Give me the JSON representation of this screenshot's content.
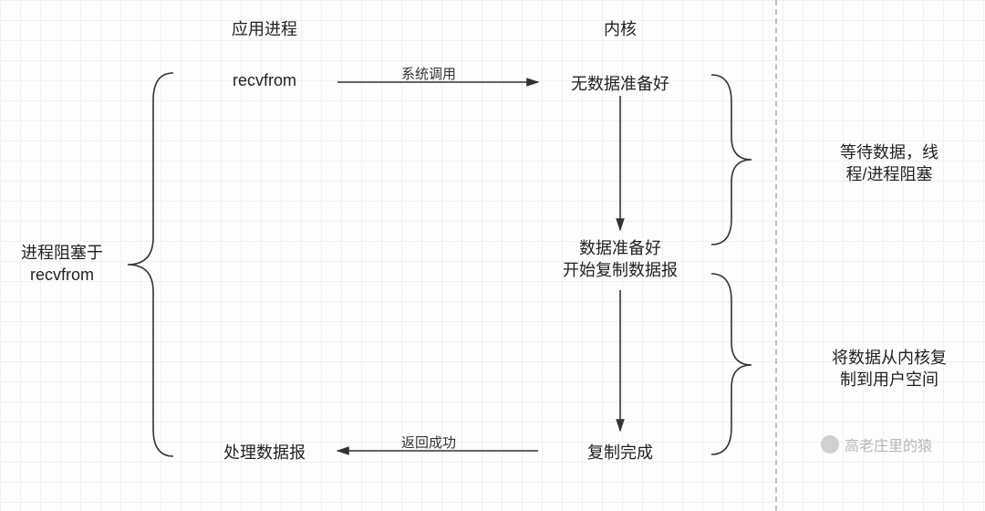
{
  "headers": {
    "app_process": "应用进程",
    "kernel": "内核"
  },
  "left": {
    "blocked_label": "进程阻塞于\nrecvfrom"
  },
  "app_col": {
    "recvfrom": "recvfrom",
    "process_datagram": "处理数据报"
  },
  "arrows": {
    "syscall": "系统调用",
    "return_ok": "返回成功"
  },
  "kernel_col": {
    "no_data": "无数据准备好",
    "data_ready": "数据准备好\n开始复制数据报",
    "copy_done": "复制完成"
  },
  "right": {
    "wait_data": "等待数据，线\n程/进程阻塞",
    "copy_to_user": "将数据从内核复\n制到用户空间"
  },
  "watermark": "高老庄里的猿"
}
